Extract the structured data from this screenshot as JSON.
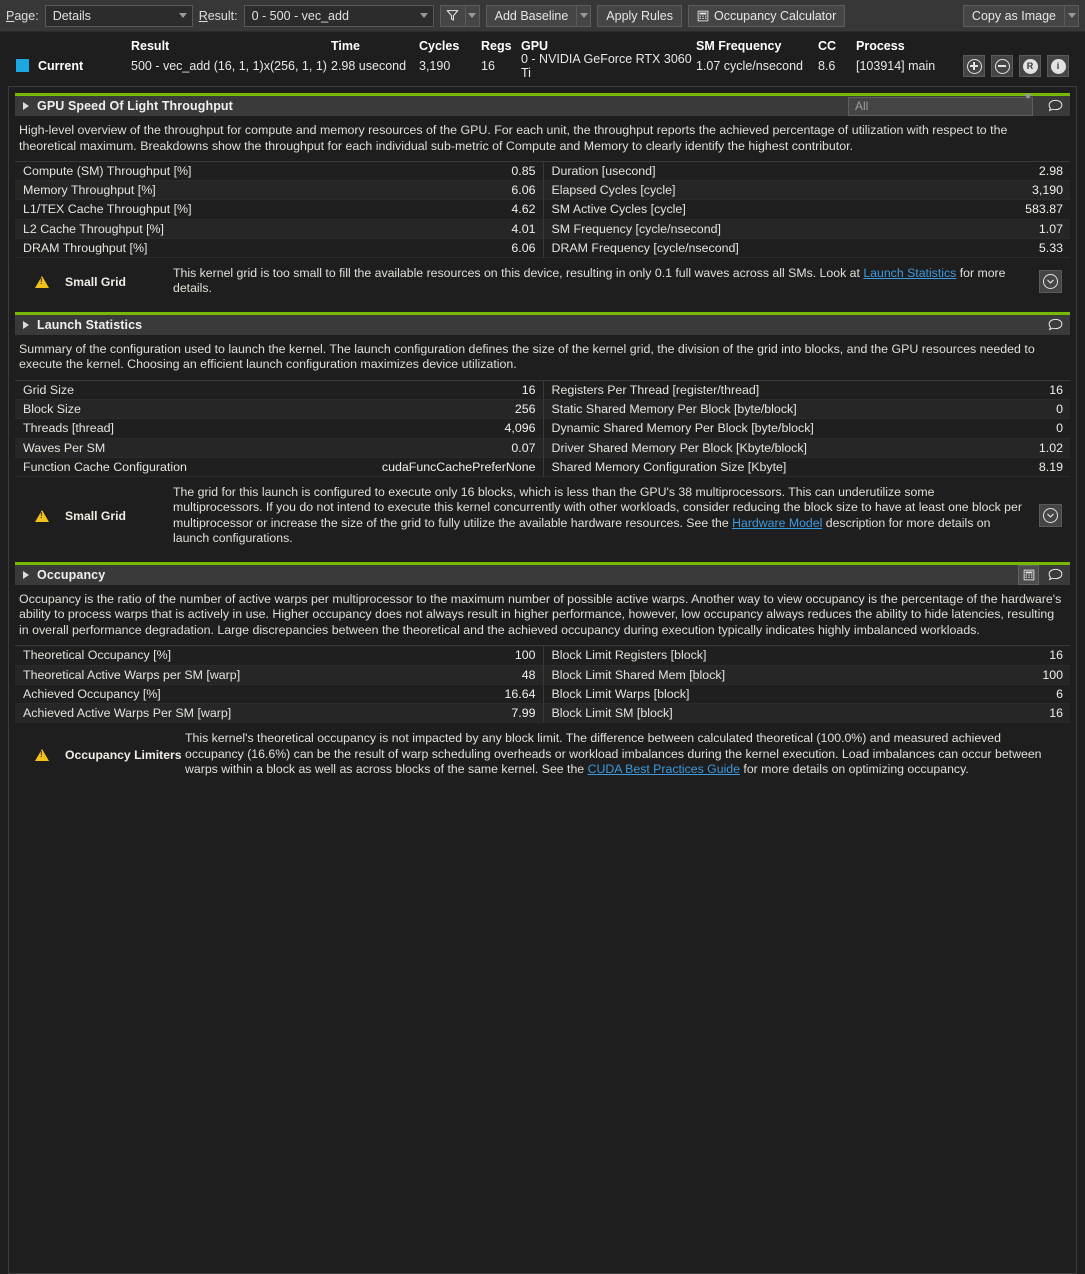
{
  "toolbar": {
    "page_label": "Page:",
    "page_value": "Details",
    "result_label": "Result:",
    "result_value": "0 -   500 - vec_add",
    "filter_icon": "funnel-icon",
    "add_baseline_label": "Add Baseline",
    "apply_rules_label": "Apply Rules",
    "occupancy_calculator_label": "Occupancy Calculator",
    "occupancy_calculator_icon": "calculator-icon",
    "copy_as_image_label": "Copy as Image"
  },
  "summary": {
    "columns": {
      "label": "",
      "result": "Result",
      "time": "Time",
      "cycles": "Cycles",
      "regs": "Regs",
      "gpu": "GPU",
      "sm_frequency": "SM Frequency",
      "cc": "CC",
      "process": "Process"
    },
    "row": {
      "label": "Current",
      "result": "500 - vec_add (16, 1, 1)x(256, 1, 1)",
      "time": "2.98 usecond",
      "cycles": "3,190",
      "regs": "16",
      "gpu": "0 - NVIDIA GeForce RTX 3060 Ti",
      "sm_frequency": "1.07 cycle/nsecond",
      "cc": "8.6",
      "process": "[103914] main"
    },
    "swatch_color": "#1ca7e0",
    "icons": [
      {
        "name": "zoom-in-icon",
        "glyph": "+"
      },
      {
        "name": "zoom-out-icon",
        "glyph": "−"
      },
      {
        "name": "reset-icon",
        "glyph": "R"
      },
      {
        "name": "info-icon",
        "glyph": "i"
      }
    ]
  },
  "accent_color": "#76b900",
  "link_color": "#3d9ae0",
  "sections": [
    {
      "id": "speed-of-light",
      "title": "GPU Speed Of Light Throughput",
      "filter_placeholder": "All",
      "description": "High-level overview of the throughput for compute and memory resources of the GPU. For each unit, the throughput reports the achieved percentage of utilization with respect to the theoretical maximum. Breakdowns show the throughput for each individual sub-metric of Compute and Memory to clearly identify the highest contributor.",
      "metrics_left": [
        {
          "name": "Compute (SM) Throughput [%]",
          "value": "0.85"
        },
        {
          "name": "Memory Throughput [%]",
          "value": "6.06"
        },
        {
          "name": "L1/TEX Cache Throughput [%]",
          "value": "4.62"
        },
        {
          "name": "L2 Cache Throughput [%]",
          "value": "4.01"
        },
        {
          "name": "DRAM Throughput [%]",
          "value": "6.06"
        }
      ],
      "metrics_right": [
        {
          "name": "Duration [usecond]",
          "value": "2.98"
        },
        {
          "name": "Elapsed Cycles [cycle]",
          "value": "3,190"
        },
        {
          "name": "SM Active Cycles [cycle]",
          "value": "583.87"
        },
        {
          "name": "SM Frequency [cycle/nsecond]",
          "value": "1.07"
        },
        {
          "name": "DRAM Frequency [cycle/nsecond]",
          "value": "5.33"
        }
      ],
      "rule": {
        "name": "Small Grid",
        "text_before": "This kernel grid is too small to fill the available resources on this device, resulting in only 0.1 full waves across all SMs. Look at ",
        "link": "Launch Statistics",
        "text_after": " for more details."
      }
    },
    {
      "id": "launch-statistics",
      "title": "Launch Statistics",
      "description": "Summary of the configuration used to launch the kernel. The launch configuration defines the size of the kernel grid, the division of the grid into blocks, and the GPU resources needed to execute the kernel. Choosing an efficient launch configuration maximizes device utilization.",
      "metrics_left": [
        {
          "name": "Grid Size",
          "value": "16"
        },
        {
          "name": "Block Size",
          "value": "256"
        },
        {
          "name": "Threads [thread]",
          "value": "4,096"
        },
        {
          "name": "Waves Per SM",
          "value": "0.07"
        },
        {
          "name": "Function Cache Configuration",
          "value": "cudaFuncCachePreferNone"
        }
      ],
      "metrics_right": [
        {
          "name": "Registers Per Thread [register/thread]",
          "value": "16"
        },
        {
          "name": "Static Shared Memory Per Block [byte/block]",
          "value": "0"
        },
        {
          "name": "Dynamic Shared Memory Per Block [byte/block]",
          "value": "0"
        },
        {
          "name": "Driver Shared Memory Per Block [Kbyte/block]",
          "value": "1.02"
        },
        {
          "name": "Shared Memory Configuration Size [Kbyte]",
          "value": "8.19"
        }
      ],
      "rule": {
        "name": "Small Grid",
        "text_before": "The grid for this launch is configured to execute only 16 blocks, which is less than the GPU's 38 multiprocessors. This can underutilize some multiprocessors. If you do not intend to execute this kernel concurrently with other workloads, consider reducing the block size to have at least one block per multiprocessor or increase the size of the grid to fully utilize the available hardware resources. See the ",
        "link": "Hardware Model",
        "text_after": " description for more details on launch configurations."
      }
    },
    {
      "id": "occupancy",
      "title": "Occupancy",
      "description": "Occupancy is the ratio of the number of active warps per multiprocessor to the maximum number of possible active warps. Another way to view occupancy is the percentage of the hardware's ability to process warps that is actively in use. Higher occupancy does not always result in higher performance, however, low occupancy always reduces the ability to hide latencies, resulting in overall performance degradation. Large discrepancies between the theoretical and the achieved occupancy during execution typically indicates highly imbalanced workloads.",
      "metrics_left": [
        {
          "name": "Theoretical Occupancy [%]",
          "value": "100"
        },
        {
          "name": "Theoretical Active Warps per SM [warp]",
          "value": "48"
        },
        {
          "name": "Achieved Occupancy [%]",
          "value": "16.64"
        },
        {
          "name": "Achieved Active Warps Per SM [warp]",
          "value": "7.99"
        }
      ],
      "metrics_right": [
        {
          "name": "Block Limit Registers [block]",
          "value": "16"
        },
        {
          "name": "Block Limit Shared Mem [block]",
          "value": "100"
        },
        {
          "name": "Block Limit Warps [block]",
          "value": "6"
        },
        {
          "name": "Block Limit SM [block]",
          "value": "16"
        }
      ],
      "rule": {
        "name": "Occupancy Limiters",
        "text_before": "This kernel's theoretical occupancy is not impacted by any block limit. The difference between calculated theoretical (100.0%) and measured achieved occupancy (16.6%) can be the result of warp scheduling overheads or workload imbalances during the kernel execution. Load imbalances can occur between warps within a block as well as across blocks of the same kernel. See the ",
        "link": "CUDA Best Practices Guide",
        "text_after": " for more details on optimizing occupancy."
      }
    }
  ]
}
